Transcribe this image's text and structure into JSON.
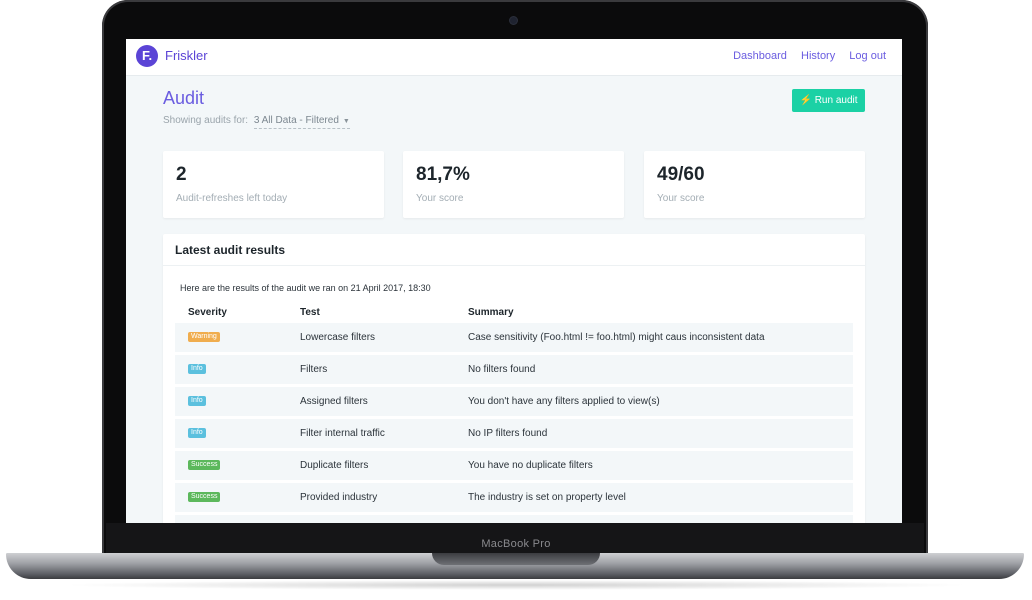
{
  "device": {
    "label": "MacBook Pro"
  },
  "app": {
    "logo_letter": "F.",
    "name": "Friskler"
  },
  "nav": {
    "items": [
      {
        "label": "Dashboard"
      },
      {
        "label": "History"
      },
      {
        "label": "Log out"
      }
    ]
  },
  "page": {
    "title": "Audit",
    "showing_label": "Showing audits for:",
    "showing_value": "3 All Data - Filtered",
    "run_button": "Run audit"
  },
  "stats": [
    {
      "value": "2",
      "label": "Audit-refreshes left today"
    },
    {
      "value": "81,7%",
      "label": "Your score"
    },
    {
      "value": "49/60",
      "label": "Your score"
    }
  ],
  "results": {
    "title": "Latest audit results",
    "intro": "Here are the results of the audit we ran on 21 April 2017, 18:30",
    "columns": [
      "Severity",
      "Test",
      "Summary"
    ],
    "rows": [
      {
        "severity": "Warning",
        "color": "#f0ad4e",
        "test": "Lowercase filters",
        "summary": "Case sensitivity (Foo.html != foo.html) might caus inconsistent data"
      },
      {
        "severity": "Info",
        "color": "#5bc0de",
        "test": "Filters",
        "summary": "No filters found"
      },
      {
        "severity": "Info",
        "color": "#5bc0de",
        "test": "Assigned filters",
        "summary": "You don't have any filters applied to view(s)"
      },
      {
        "severity": "Info",
        "color": "#5bc0de",
        "test": "Filter internal traffic",
        "summary": "No IP filters found"
      },
      {
        "severity": "Success",
        "color": "#5cb85c",
        "test": "Duplicate filters",
        "summary": "You have no duplicate filters"
      },
      {
        "severity": "Success",
        "color": "#5cb85c",
        "test": "Provided industry",
        "summary": "The industry is set on property level"
      }
    ]
  },
  "colors": {
    "accent": "#6a5ce0",
    "logo": "#5b44d6",
    "run_button": "#1bd1a5"
  }
}
